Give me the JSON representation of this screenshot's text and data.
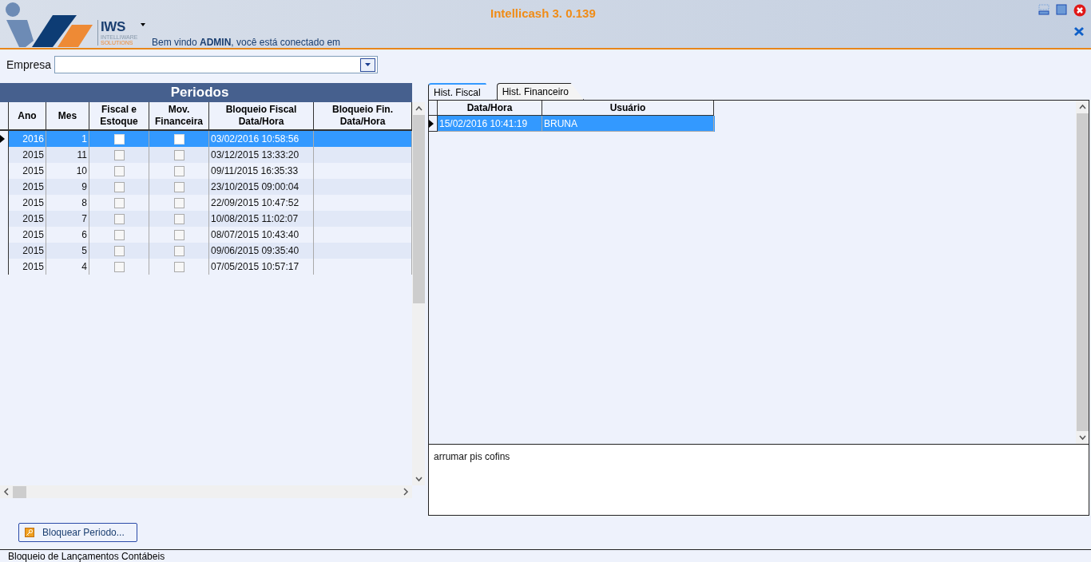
{
  "window": {
    "title": "Intellicash 3. 0.139"
  },
  "logo": {
    "name": "IWS",
    "line_1": "INTELLIWARE",
    "line_2": "SOLUTIONS"
  },
  "welcome": "Bem vindo **ADMIN**, você está conectado em",
  "empresa": {
    "label": "Empresa"
  },
  "periodos": {
    "title": "Periodos",
    "columns": [
      "Ano",
      "Mes",
      "Fiscal e Estoque",
      "Mov. Financeira",
      "Bloqueio Fiscal Data/Hora",
      "Bloqueio Fin. Data/Hora"
    ],
    "rows": [
      {
        "ano": "2016",
        "mes": "1",
        "fiscal": false,
        "financeira": false,
        "bloqueio_fiscal": "03/02/2016 10:58:56",
        "selected": true
      },
      {
        "ano": "2015",
        "mes": "11",
        "fiscal": false,
        "financeira": false,
        "bloqueio_fiscal": "03/12/2015 13:33:20",
        "selected": false
      },
      {
        "ano": "2015",
        "mes": "10",
        "fiscal": false,
        "financeira": false,
        "bloqueio_fiscal": "09/11/2015 16:35:33",
        "selected": false
      },
      {
        "ano": "2015",
        "mes": "9",
        "fiscal": false,
        "financeira": false,
        "bloqueio_fiscal": "23/10/2015 09:00:04",
        "selected": false
      },
      {
        "ano": "2015",
        "mes": "8",
        "fiscal": false,
        "financeira": false,
        "bloqueio_fiscal": "22/09/2015 10:47:52",
        "selected": false
      },
      {
        "ano": "2015",
        "mes": "7",
        "fiscal": false,
        "financeira": false,
        "bloqueio_fiscal": "10/08/2015 11:02:07",
        "selected": false
      },
      {
        "ano": "2015",
        "mes": "6",
        "fiscal": false,
        "financeira": false,
        "bloqueio_fiscal": "08/07/2015 10:43:40",
        "selected": false
      },
      {
        "ano": "2015",
        "mes": "5",
        "fiscal": false,
        "financeira": false,
        "bloqueio_fiscal": "09/06/2015 09:35:40",
        "selected": false
      },
      {
        "ano": "2015",
        "mes": "4",
        "fiscal": false,
        "financeira": false,
        "bloqueio_fiscal": "07/05/2015 10:57:17",
        "selected": false
      }
    ]
  },
  "hist_tabs": [
    {
      "label": "Hist. Fiscal",
      "selected": true
    },
    {
      "label": "Hist. Financeiro",
      "selected": false
    }
  ],
  "hist": {
    "columns": [
      "Data/Hora",
      "Usuário"
    ],
    "rows": [
      {
        "data_hora": "15/02/2016 10:41:19",
        "usuario": "BRUNA",
        "selected": true
      }
    ],
    "note": "arrumar pis cofins"
  },
  "bloquear_button": "Bloquear Periodo...",
  "bottom_tabs": [
    {
      "label": "Bloqueio de Lançamentos Contábeis",
      "selected": true
    }
  ]
}
